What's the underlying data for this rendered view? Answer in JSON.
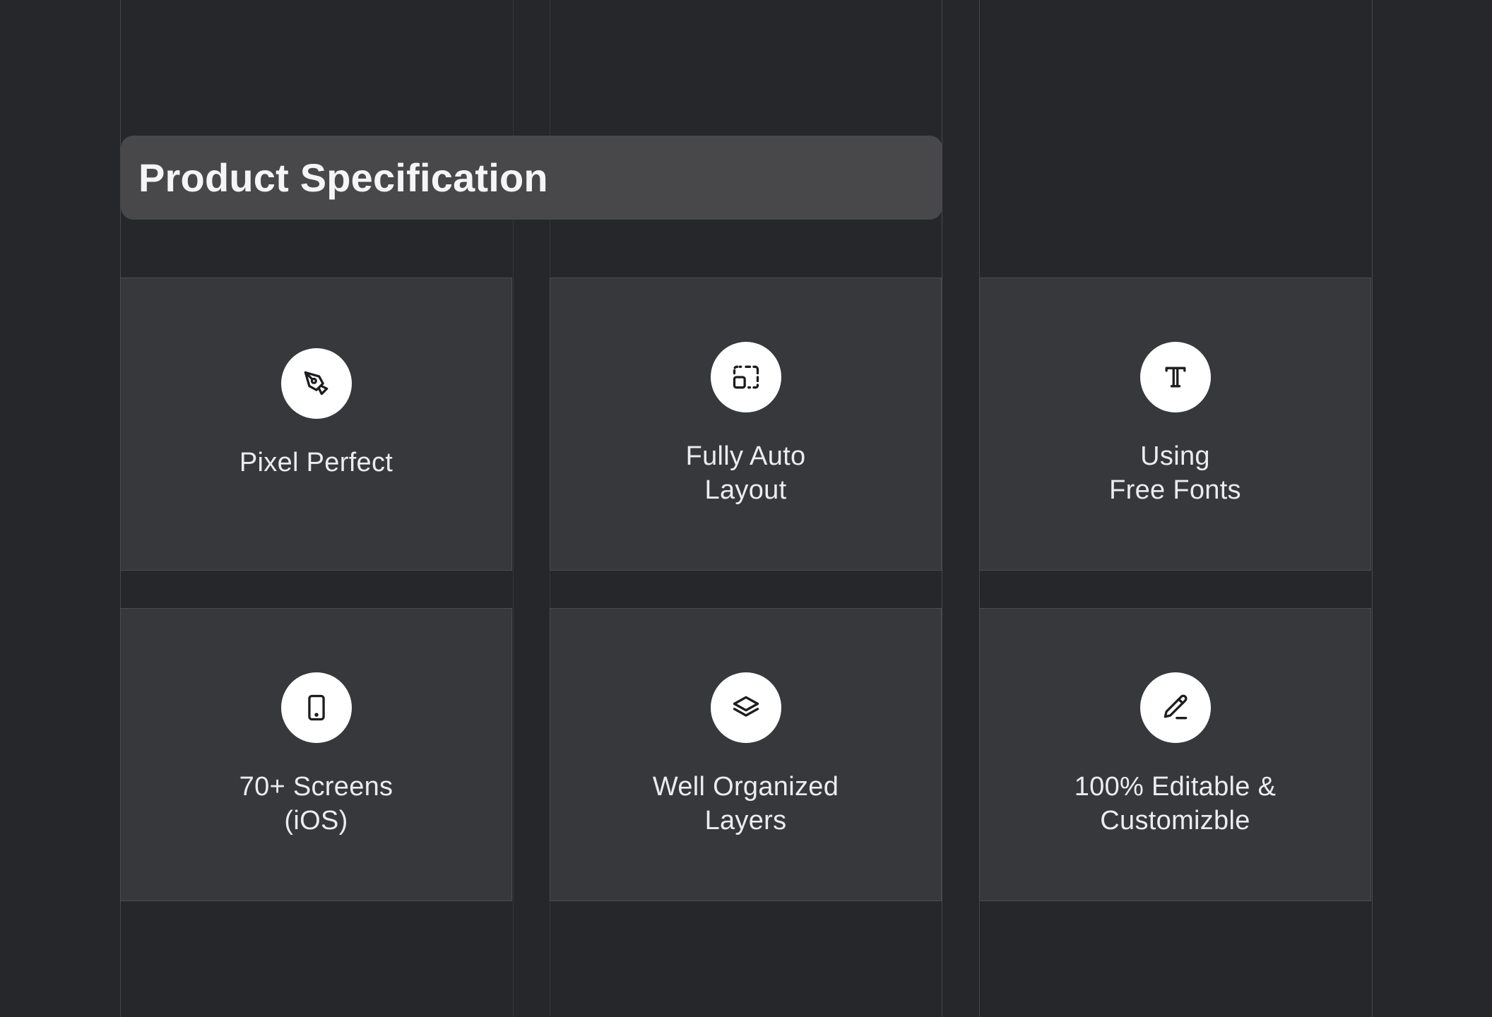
{
  "header": {
    "title": "Product Specification"
  },
  "features": [
    {
      "icon": "pen-tool-icon",
      "label": "Pixel Perfect"
    },
    {
      "icon": "auto-layout-icon",
      "label": "Fully Auto\nLayout"
    },
    {
      "icon": "typography-icon",
      "label": "Using\nFree Fonts"
    },
    {
      "icon": "mobile-device-icon",
      "label": "70+ Screens\n(iOS)"
    },
    {
      "icon": "layers-icon",
      "label": "Well Organized\nLayers"
    },
    {
      "icon": "edit-pencil-icon",
      "label": "100% Editable &\nCustomizble"
    }
  ],
  "colors": {
    "background": "#26272b",
    "card": "#37383c",
    "title_bar": "#48484a",
    "icon_circle": "#ffffff"
  }
}
